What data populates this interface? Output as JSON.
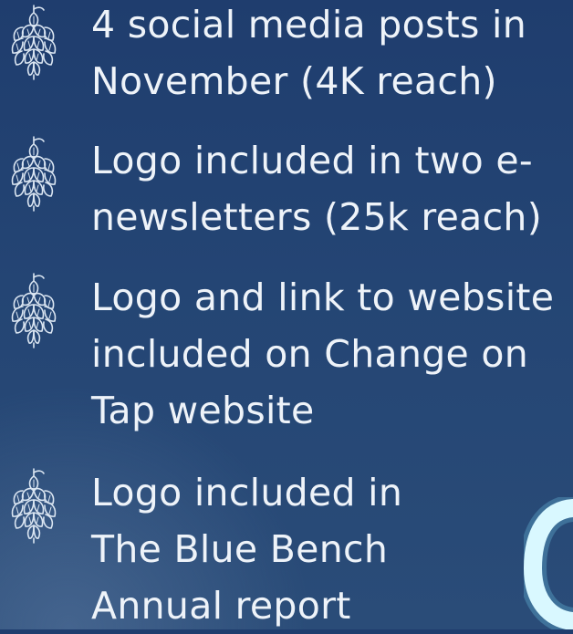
{
  "items": [
    {
      "text": "4 social media posts in\nNovember (4K reach)",
      "icon": "hop-icon"
    },
    {
      "text": "Logo included in two e-\nnewsletters (25k reach)",
      "icon": "hop-icon"
    },
    {
      "text": "Logo and link to website\nincluded on Change on\nTap website",
      "icon": "hop-icon"
    },
    {
      "text": "Logo included in\nThe Blue Bench\nAnnual report",
      "icon": "hop-icon"
    }
  ],
  "colors": {
    "background": "#244574",
    "text": "#eef3f9",
    "icon_stroke": "#dbe6f2",
    "accent_glow": "#7fe3ff"
  }
}
